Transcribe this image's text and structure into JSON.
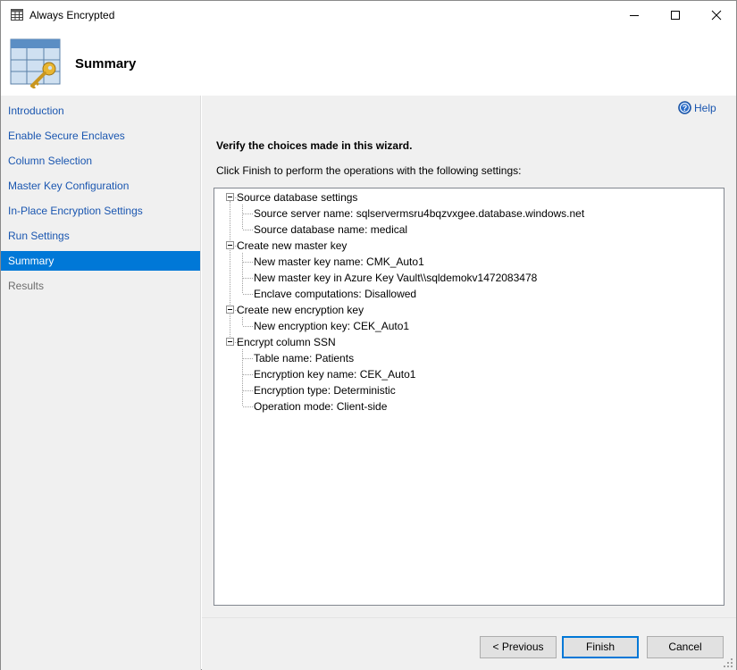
{
  "window": {
    "title": "Always Encrypted",
    "controls": {
      "minimize": "minimize-icon",
      "maximize": "maximize-icon",
      "close": "close-icon"
    }
  },
  "header": {
    "title": "Summary",
    "icon": "table-key-icon"
  },
  "nav": {
    "items": [
      {
        "label": "Introduction",
        "state": "link"
      },
      {
        "label": "Enable Secure Enclaves",
        "state": "link"
      },
      {
        "label": "Column Selection",
        "state": "link"
      },
      {
        "label": "Master Key Configuration",
        "state": "link"
      },
      {
        "label": "In-Place Encryption Settings",
        "state": "link"
      },
      {
        "label": "Run Settings",
        "state": "link"
      },
      {
        "label": "Summary",
        "state": "active"
      },
      {
        "label": "Results",
        "state": "disabled"
      }
    ]
  },
  "main": {
    "help_label": "Help",
    "verify_heading": "Verify the choices made in this wizard.",
    "instruction": "Click Finish to perform the operations with the following settings:",
    "tree": [
      {
        "label": "Source database settings",
        "children": [
          "Source server name: sqlservermsru4bqzvxgee.database.windows.net",
          "Source database name: medical"
        ]
      },
      {
        "label": "Create new master key",
        "children": [
          "New master key name: CMK_Auto1",
          "New master key in Azure Key Vault\\\\sqldemokv1472083478",
          "Enclave computations: Disallowed"
        ]
      },
      {
        "label": "Create new encryption key",
        "children": [
          "New encryption key: CEK_Auto1"
        ]
      },
      {
        "label": "Encrypt column SSN",
        "children": [
          "Table name: Patients",
          "Encryption key name: CEK_Auto1",
          "Encryption type: Deterministic",
          "Operation mode: Client-side"
        ]
      }
    ]
  },
  "footer": {
    "previous_label": "< Previous",
    "finish_label": "Finish",
    "cancel_label": "Cancel"
  },
  "colors": {
    "accent": "#0078d7",
    "link": "#1a56b0",
    "panel_bg": "#f0f0f0",
    "disabled_text": "#6d6d6d"
  }
}
